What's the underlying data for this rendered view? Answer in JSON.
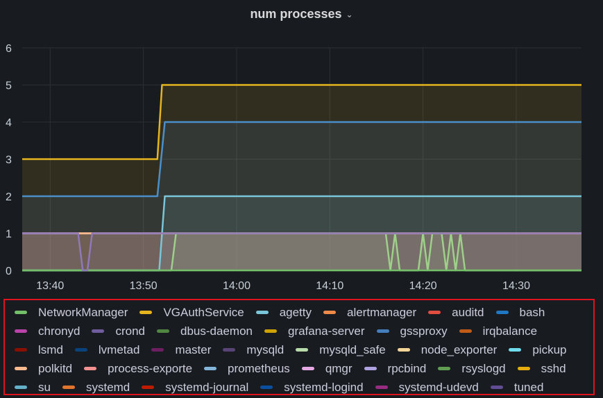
{
  "panel": {
    "title": "num processes"
  },
  "chart_data": {
    "type": "area",
    "x_ticks": [
      "13:40",
      "13:50",
      "14:00",
      "14:10",
      "14:20",
      "14:30"
    ],
    "x_range": [
      "13:37",
      "14:37"
    ],
    "ylim": [
      0,
      6
    ],
    "y_ticks": [
      "0",
      "1",
      "2",
      "3",
      "4",
      "5",
      "6"
    ],
    "grid": true,
    "stacked": false,
    "series": [
      {
        "name": "VGAuthService",
        "color": "#e6b41e",
        "points": [
          [
            "13:37",
            3
          ],
          [
            "13:51.5",
            3
          ],
          [
            "13:52",
            5
          ],
          [
            "14:37",
            5
          ]
        ]
      },
      {
        "name": "bash",
        "color": "#4a8fca",
        "points": [
          [
            "13:37",
            2
          ],
          [
            "13:51.5",
            2
          ],
          [
            "13:52.3",
            4
          ],
          [
            "14:37",
            4
          ]
        ]
      },
      {
        "name": "agetty",
        "color": "#7ac6d9",
        "points": [
          [
            "13:37",
            0
          ],
          [
            "13:51.7",
            0
          ],
          [
            "13:52.3",
            2
          ],
          [
            "14:37",
            2
          ]
        ]
      },
      {
        "name": "node_exporter",
        "color": "#f2c596",
        "points": [
          [
            "13:37",
            1
          ],
          [
            "14:37",
            1
          ]
        ]
      },
      {
        "name": "process-exporte",
        "color": "#e9a4a4",
        "points": [
          [
            "13:37",
            1
          ],
          [
            "14:37",
            1
          ]
        ]
      },
      {
        "name": "polkitd",
        "color": "#f9b98c",
        "points": [
          [
            "13:37",
            1
          ],
          [
            "14:37",
            1
          ]
        ]
      },
      {
        "name": "mysqld_safe",
        "color": "#9ed08a",
        "points": [
          [
            "13:37",
            0
          ],
          [
            "13:53",
            0
          ],
          [
            "13:53.5",
            1
          ],
          [
            "14:16",
            1
          ],
          [
            "14:16.5",
            0
          ],
          [
            "14:17",
            1
          ],
          [
            "14:17.5",
            0
          ],
          [
            "14:19.5",
            0
          ],
          [
            "14:20",
            1
          ],
          [
            "14:20.5",
            0
          ],
          [
            "14:21",
            1
          ],
          [
            "14:22",
            1
          ],
          [
            "14:22.5",
            0
          ],
          [
            "14:23",
            1
          ],
          [
            "14:23.5",
            0
          ],
          [
            "14:24",
            1
          ],
          [
            "14:24.5",
            0
          ],
          [
            "14:37",
            0
          ]
        ]
      },
      {
        "name": "NetworkManager",
        "color": "#73bf69",
        "points": [
          [
            "13:37",
            0
          ],
          [
            "14:37",
            0
          ]
        ]
      },
      {
        "name": "crond",
        "color": "#8f79b8",
        "points": [
          [
            "13:37",
            1
          ],
          [
            "13:43",
            1
          ],
          [
            "13:43.5",
            0
          ],
          [
            "13:44",
            0
          ],
          [
            "13:44.5",
            1
          ],
          [
            "14:37",
            1
          ]
        ]
      }
    ],
    "legend_placement": "bottom"
  },
  "legend": {
    "rows": [
      [
        {
          "label": "NetworkManager",
          "color": "#73bf69"
        },
        {
          "label": "VGAuthService",
          "color": "#e6b41e"
        },
        {
          "label": "agetty",
          "color": "#7ac6d9"
        },
        {
          "label": "alertmanager",
          "color": "#ef8a48"
        },
        {
          "label": "auditd",
          "color": "#e24d42"
        },
        {
          "label": "bash",
          "color": "#1f78c1"
        }
      ],
      [
        {
          "label": "chronyd",
          "color": "#ba43a9"
        },
        {
          "label": "crond",
          "color": "#705da0"
        },
        {
          "label": "dbus-daemon",
          "color": "#508642"
        },
        {
          "label": "grafana-server",
          "color": "#cca300"
        },
        {
          "label": "gssproxy",
          "color": "#447ebc"
        },
        {
          "label": "irqbalance",
          "color": "#c15c17"
        }
      ],
      [
        {
          "label": "lsmd",
          "color": "#890f02"
        },
        {
          "label": "lvmetad",
          "color": "#0a437c"
        },
        {
          "label": "master",
          "color": "#6d1f62"
        },
        {
          "label": "mysqld",
          "color": "#584477"
        },
        {
          "label": "mysqld_safe",
          "color": "#b7dbab"
        },
        {
          "label": "node_exporter",
          "color": "#f4d598"
        },
        {
          "label": "pickup",
          "color": "#70dbed"
        }
      ],
      [
        {
          "label": "polkitd",
          "color": "#f9ba8f"
        },
        {
          "label": "process-exporte",
          "color": "#f29191"
        },
        {
          "label": "prometheus",
          "color": "#82b5d8"
        },
        {
          "label": "qmgr",
          "color": "#e5a8e2"
        },
        {
          "label": "rpcbind",
          "color": "#aea2e0"
        },
        {
          "label": "rsyslogd",
          "color": "#629e51"
        },
        {
          "label": "sshd",
          "color": "#e5ac0e"
        }
      ],
      [
        {
          "label": "su",
          "color": "#64b0c8"
        },
        {
          "label": "systemd",
          "color": "#e0752d"
        },
        {
          "label": "systemd-journal",
          "color": "#bf1b00"
        },
        {
          "label": "systemd-logind",
          "color": "#0a50a1"
        },
        {
          "label": "systemd-udevd",
          "color": "#962d82"
        },
        {
          "label": "tuned",
          "color": "#614d93"
        }
      ]
    ]
  }
}
